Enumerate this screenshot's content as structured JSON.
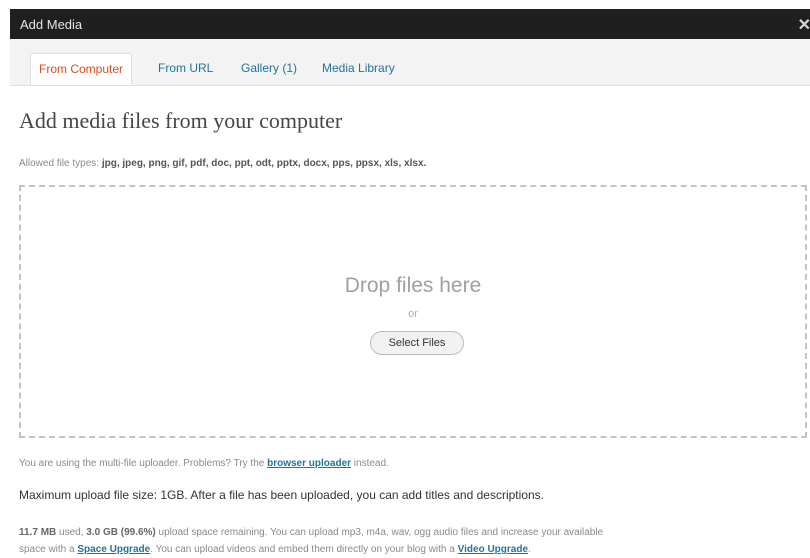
{
  "window": {
    "title": "Add Media",
    "close_icon": "close-icon"
  },
  "tabs": [
    {
      "label": "From Computer",
      "active": true
    },
    {
      "label": "From URL",
      "active": false
    },
    {
      "label": "Gallery (1)",
      "active": false
    },
    {
      "label": "Media Library",
      "active": false
    }
  ],
  "heading": "Add media files from your computer",
  "allowed": {
    "prefix": "Allowed file types:",
    "types": "jpg, jpeg, png, gif, pdf, doc, ppt, odt, pptx, docx, pps, ppsx, xls, xlsx."
  },
  "dropzone": {
    "drop_text": "Drop files here",
    "or_text": "or",
    "select_button": "Select Files"
  },
  "uploader_note": {
    "prefix": "You are using the multi-file uploader. Problems? Try the",
    "link": "browser uploader",
    "suffix": "instead."
  },
  "max_size_text": "Maximum upload file size: 1GB. After a file has been uploaded, you can add titles and descriptions.",
  "space": {
    "used": "11.7 MB",
    "used_suffix": "used,",
    "remaining": "3.0 GB (99.6%)",
    "line1_rest": "upload space remaining. You can upload mp3, m4a, wav, ogg audio files and increase your available",
    "line2_prefix": "space with a",
    "space_upgrade_link": "Space Upgrade",
    "line2_mid": ". You can upload videos and embed them directly on your blog with a",
    "video_upgrade_link": "Video Upgrade",
    "line2_end": "."
  },
  "colors": {
    "link": "#21759b",
    "active_tab": "#d54e21",
    "titlebar": "#1f1f1f"
  }
}
